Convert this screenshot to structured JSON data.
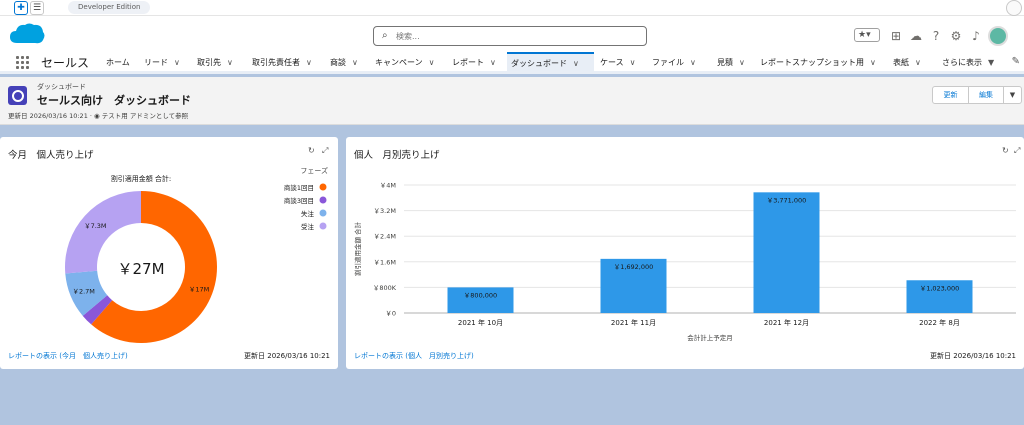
{
  "topbar": {
    "plus_icon": "plus-icon",
    "menu_icon": "hamburger-icon",
    "edition_label": "Developer Edition"
  },
  "header": {
    "search_placeholder": "検索...",
    "icons": [
      "star-icon",
      "add-icon",
      "trailhead-icon",
      "help-icon",
      "setup-gear-icon",
      "bell-icon",
      "avatar"
    ]
  },
  "nav": {
    "app_name": "セールス",
    "tabs": [
      {
        "label": "ホーム",
        "chevron": false
      },
      {
        "label": "リード",
        "chevron": true
      },
      {
        "label": "取引先",
        "chevron": true
      },
      {
        "label": "取引先責任者",
        "chevron": true
      },
      {
        "label": "商談",
        "chevron": true
      },
      {
        "label": "キャンペーン",
        "chevron": true
      },
      {
        "label": "レポート",
        "chevron": true
      },
      {
        "label": "ダッシュボード",
        "chevron": true,
        "active": true
      },
      {
        "label": "ケース",
        "chevron": true
      },
      {
        "label": "ファイル",
        "chevron": true
      },
      {
        "label": "見積",
        "chevron": true
      },
      {
        "label": "レポートスナップショット用",
        "chevron": true
      },
      {
        "label": "表紙",
        "chevron": true
      },
      {
        "label": "さらに表示",
        "chevron": true
      }
    ],
    "chevron_glyph": "∨",
    "more_glyph": "▼",
    "pencil_icon": "✎"
  },
  "page_header": {
    "object_type": "ダッシュボード",
    "title": "セールス向け　ダッシュボード",
    "meta": "更新日 2026/03/16 10:21 · ◉ テスト用 アドミンとして参照",
    "buttons": {
      "refresh": "更新",
      "edit": "編集",
      "more": "▼"
    }
  },
  "left_card": {
    "title": "今月　個人売り上げ",
    "footer_link": "レポートの表示 (今月　個人売り上げ)",
    "footer_date": "更新日 2026/03/16 10:21",
    "tool_icons": {
      "refresh": "↻",
      "expand": "⤢"
    }
  },
  "right_card": {
    "title": "個人　月別売り上げ",
    "footer_link": "レポートの表示 (個人　月別売り上げ)",
    "footer_date": "更新日 2026/03/16 10:21",
    "tool_icons": {
      "refresh": "↻",
      "expand": "⤢"
    }
  },
  "chart_data": [
    {
      "type": "pie",
      "title": "割引適用金額 合計:",
      "center_label": "￥27M",
      "legend_title": "フェーズ",
      "legend_position": "right",
      "categories": [
        "商談1回目",
        "商談3回目",
        "失注",
        "受注"
      ],
      "values": [
        17,
        0.7,
        2.7,
        7.3
      ],
      "data_labels": [
        "￥17M",
        "",
        "￥2.7M",
        "￥7.3M"
      ],
      "colors": [
        "#ff6600",
        "#8a57d9",
        "#7db2ec",
        "#b6a2f2"
      ]
    },
    {
      "type": "bar",
      "categories": [
        "2021 年 10月",
        "2021 年 11月",
        "2021 年 12月",
        "2022 年 8月"
      ],
      "values": [
        800000,
        1692000,
        3771000,
        1023000
      ],
      "data_labels": [
        "￥800,000",
        "￥1,692,000",
        "￥3,771,000",
        "￥1,023,000"
      ],
      "xlabel": "会計計上予定月",
      "ylabel": "割引適用金額 合計",
      "ylim": [
        0,
        4000000
      ],
      "yticks": [
        0,
        800000,
        1600000,
        2400000,
        3200000,
        4000000
      ],
      "ytick_labels": [
        "￥0",
        "￥800K",
        "￥1.6M",
        "￥2.4M",
        "￥3.2M",
        "￥4M"
      ],
      "grid": true,
      "color": "#2e98e8"
    }
  ]
}
